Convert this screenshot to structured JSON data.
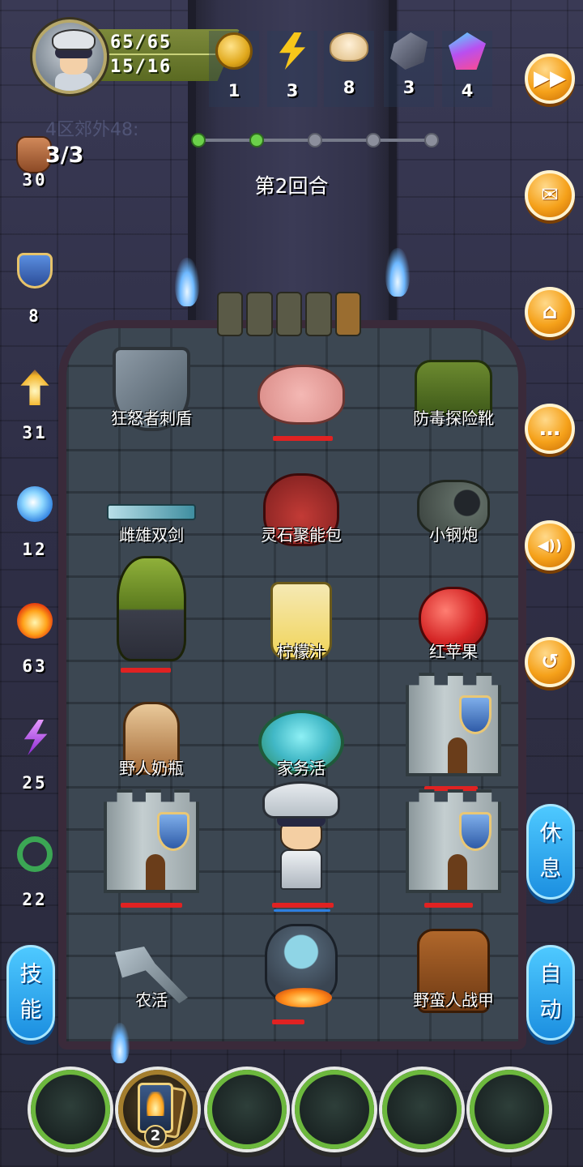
{
  "player": {
    "hp": "65/65",
    "mp": "15/16"
  },
  "resources": [
    {
      "name": "gold-coin",
      "icon": "coin-icon",
      "count": "1"
    },
    {
      "name": "energy",
      "icon": "lightning-icon",
      "count": "3"
    },
    {
      "name": "bun",
      "icon": "bun-icon",
      "count": "8"
    },
    {
      "name": "ore",
      "icon": "ore-icon",
      "count": "3"
    },
    {
      "name": "crystal",
      "icon": "crystal-icon",
      "count": "4"
    }
  ],
  "zone": {
    "label": "4区郊外48:"
  },
  "fist": {
    "count": "3/3"
  },
  "progress": {
    "total_dots": 5,
    "active_dots": 2
  },
  "round": {
    "label": "第2回合"
  },
  "left_stats": [
    {
      "icon": "fist-icon",
      "value": "30"
    },
    {
      "icon": "shield-icon",
      "value": "8"
    },
    {
      "icon": "arrow-up-icon",
      "value": "31"
    },
    {
      "icon": "water-icon",
      "value": "12"
    },
    {
      "icon": "fire-icon",
      "value": "63"
    },
    {
      "icon": "lightning-purple-icon",
      "value": "25"
    },
    {
      "icon": "poison-icon",
      "value": "22"
    }
  ],
  "side_buttons": [
    {
      "name": "fast-forward",
      "icon": "fast-forward-icon",
      "glyph": "▶▶"
    },
    {
      "name": "mail",
      "icon": "mail-icon",
      "glyph": "✉"
    },
    {
      "name": "home",
      "icon": "home-icon",
      "glyph": "⌂"
    },
    {
      "name": "chat",
      "icon": "chat-icon",
      "glyph": "…"
    },
    {
      "name": "sound",
      "icon": "speaker-icon",
      "glyph": "◀))"
    },
    {
      "name": "undo",
      "icon": "undo-icon",
      "glyph": "↺"
    }
  ],
  "buttons": {
    "rest": [
      "休",
      "息"
    ],
    "auto": [
      "自",
      "动"
    ],
    "skill": [
      "技",
      "能"
    ]
  },
  "grid": {
    "r1c1": {
      "label": "狂怒者刺盾"
    },
    "r1c3": {
      "label": "防毒探险靴"
    },
    "r2c1": {
      "label": "雌雄双剑"
    },
    "r2c2": {
      "label": "灵石聚能包"
    },
    "r2c3": {
      "label": "小钢炮"
    },
    "r3c2": {
      "label": "柠檬汁"
    },
    "r3c3": {
      "label": "红苹果"
    },
    "r4c1": {
      "label": "野人奶瓶"
    },
    "r4c2": {
      "label": "家务活"
    },
    "r6c1": {
      "label": "农活"
    },
    "r6c3": {
      "label": "野蛮人战甲"
    }
  },
  "hand": {
    "card_count": "2"
  },
  "colors": {
    "hp_bar": "#e02222",
    "mp_bar": "#2d7fe0",
    "slot_ring": "#6cb83d",
    "orange_button": "#f5a11a",
    "blue_button": "#1c8fe0"
  }
}
